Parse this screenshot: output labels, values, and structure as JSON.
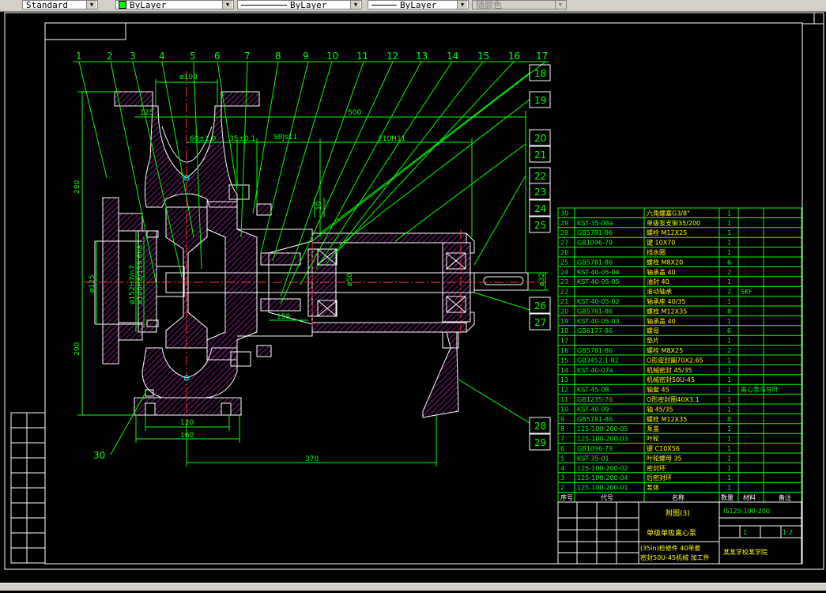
{
  "toolbar": {
    "text_style": "Standard",
    "layer": "ByLayer",
    "linetype": "ByLayer",
    "lineweight": "ByLayer",
    "plot_style": "随颜色",
    "layer_color": "#00ff00"
  },
  "drawing": {
    "balloons_top": [
      "1",
      "2",
      "3",
      "4",
      "5",
      "6",
      "7",
      "8",
      "9",
      "10",
      "11",
      "12",
      "13",
      "14",
      "15",
      "16",
      "17"
    ],
    "balloons_right": [
      "18",
      "19",
      "20",
      "21",
      "22",
      "23",
      "24",
      "25",
      "26",
      "27",
      "28",
      "29"
    ],
    "balloon_left": "30",
    "dims": {
      "d100": "ø100",
      "d125": "125",
      "d500": "500",
      "d60": "60±1.0",
      "d35": "35±0.1",
      "d98": "98Js11",
      "d210": "210H11",
      "d280": "280",
      "d200": "200",
      "d125v": "ø125",
      "d152": "ø152H7/n7",
      "d140": "ø140H8/139.6h8",
      "d120": "120",
      "d160": "160",
      "d370": "370",
      "d32": "ø32",
      "d10": "10",
      "d50": "ø50",
      "d159": "159"
    }
  },
  "bom": {
    "rows": [
      {
        "no": "30",
        "code": "",
        "name": "六角螺塞G3/8\"",
        "qty": "1",
        "note": ""
      },
      {
        "no": "29",
        "code": "KST-35-08a",
        "name": "单级泵支架35/200",
        "qty": "1",
        "note": ""
      },
      {
        "no": "28",
        "code": "GB5781-86",
        "name": "螺栓 M12X25",
        "qty": "1",
        "note": ""
      },
      {
        "no": "27",
        "code": "GB1096-79",
        "name": "键 10X70",
        "qty": "1",
        "note": ""
      },
      {
        "no": "26",
        "code": "",
        "name": "挡水圈",
        "qty": "1",
        "note": ""
      },
      {
        "no": "25",
        "code": "GB5781-86",
        "name": "螺栓 M8X20",
        "qty": "6",
        "note": ""
      },
      {
        "no": "24",
        "code": "KST-40-05-04",
        "name": "轴承盖 40",
        "qty": "2",
        "note": ""
      },
      {
        "no": "23",
        "code": "KST-40-05-05",
        "name": "油封 40",
        "qty": "1",
        "note": ""
      },
      {
        "no": "22",
        "code": "",
        "name": "滚动轴承",
        "qty": "2",
        "note": "SKF"
      },
      {
        "no": "21",
        "code": "KST-40-05-02",
        "name": "轴承座 40/35",
        "qty": "1",
        "note": ""
      },
      {
        "no": "20",
        "code": "GB5781-86",
        "name": "螺栓 M12X35",
        "qty": "8",
        "note": ""
      },
      {
        "no": "19",
        "code": "KST-40-05-03",
        "name": "轴承盖 40",
        "qty": "1",
        "note": ""
      },
      {
        "no": "18",
        "code": "GB6177-86",
        "name": "螺母",
        "qty": "6",
        "note": ""
      },
      {
        "no": "17",
        "code": "",
        "name": "垫片",
        "qty": "1",
        "note": ""
      },
      {
        "no": "16",
        "code": "GB5781-86",
        "name": "螺栓 M8X25",
        "qty": "2",
        "note": ""
      },
      {
        "no": "15",
        "code": "GB3452.1-82",
        "name": "O形密封圈70X2.65",
        "qty": "1",
        "note": ""
      },
      {
        "no": "14",
        "code": "KST-40-07a",
        "name": "机械密封 45/35",
        "qty": "1",
        "note": ""
      },
      {
        "no": "13",
        "code": "",
        "name": "机械密封50U-45",
        "qty": "1",
        "note": ""
      },
      {
        "no": "12",
        "code": "KST-45-08",
        "name": "轴套 45",
        "qty": "1",
        "note": "离心泵与导叶"
      },
      {
        "no": "11",
        "code": "GB1235-76",
        "name": "O形密封圈40X3.1",
        "qty": "1",
        "note": ""
      },
      {
        "no": "10",
        "code": "KST-40-09",
        "name": "轴 45/35",
        "qty": "1",
        "note": ""
      },
      {
        "no": "9",
        "code": "GB5781-86",
        "name": "螺栓 M12X35",
        "qty": "8",
        "note": ""
      },
      {
        "no": "8",
        "code": "125-100-200-05",
        "name": "泵盖",
        "qty": "1",
        "note": ""
      },
      {
        "no": "7",
        "code": "125-100-200-03",
        "name": "叶轮",
        "qty": "1",
        "note": ""
      },
      {
        "no": "6",
        "code": "GB1096-79",
        "name": "键 C10X56",
        "qty": "1",
        "note": ""
      },
      {
        "no": "5",
        "code": "KST-35-01",
        "name": "叶轮螺母 35",
        "qty": "1",
        "note": ""
      },
      {
        "no": "4",
        "code": "125-100-200-02",
        "name": "密封环",
        "qty": "1",
        "note": ""
      },
      {
        "no": "3",
        "code": "125-100-200-04",
        "name": "后密封环",
        "qty": "1",
        "note": ""
      },
      {
        "no": "2",
        "code": "125-100-200-01",
        "name": "泵体",
        "qty": "1",
        "note": ""
      }
    ],
    "header": [
      "序号",
      "代号",
      "名称",
      "数量",
      "材料",
      "备注"
    ]
  },
  "title_block": {
    "sheet_label": "附图(3)",
    "name": "单级单吸离心泵",
    "code": "IS125-100-200",
    "scale": "1:2",
    "sheet": "1",
    "school": "某某学校某学院",
    "note_line1": "(35in)检修件 40单套",
    "note_line2": "密封50U-45机械 加工件"
  }
}
